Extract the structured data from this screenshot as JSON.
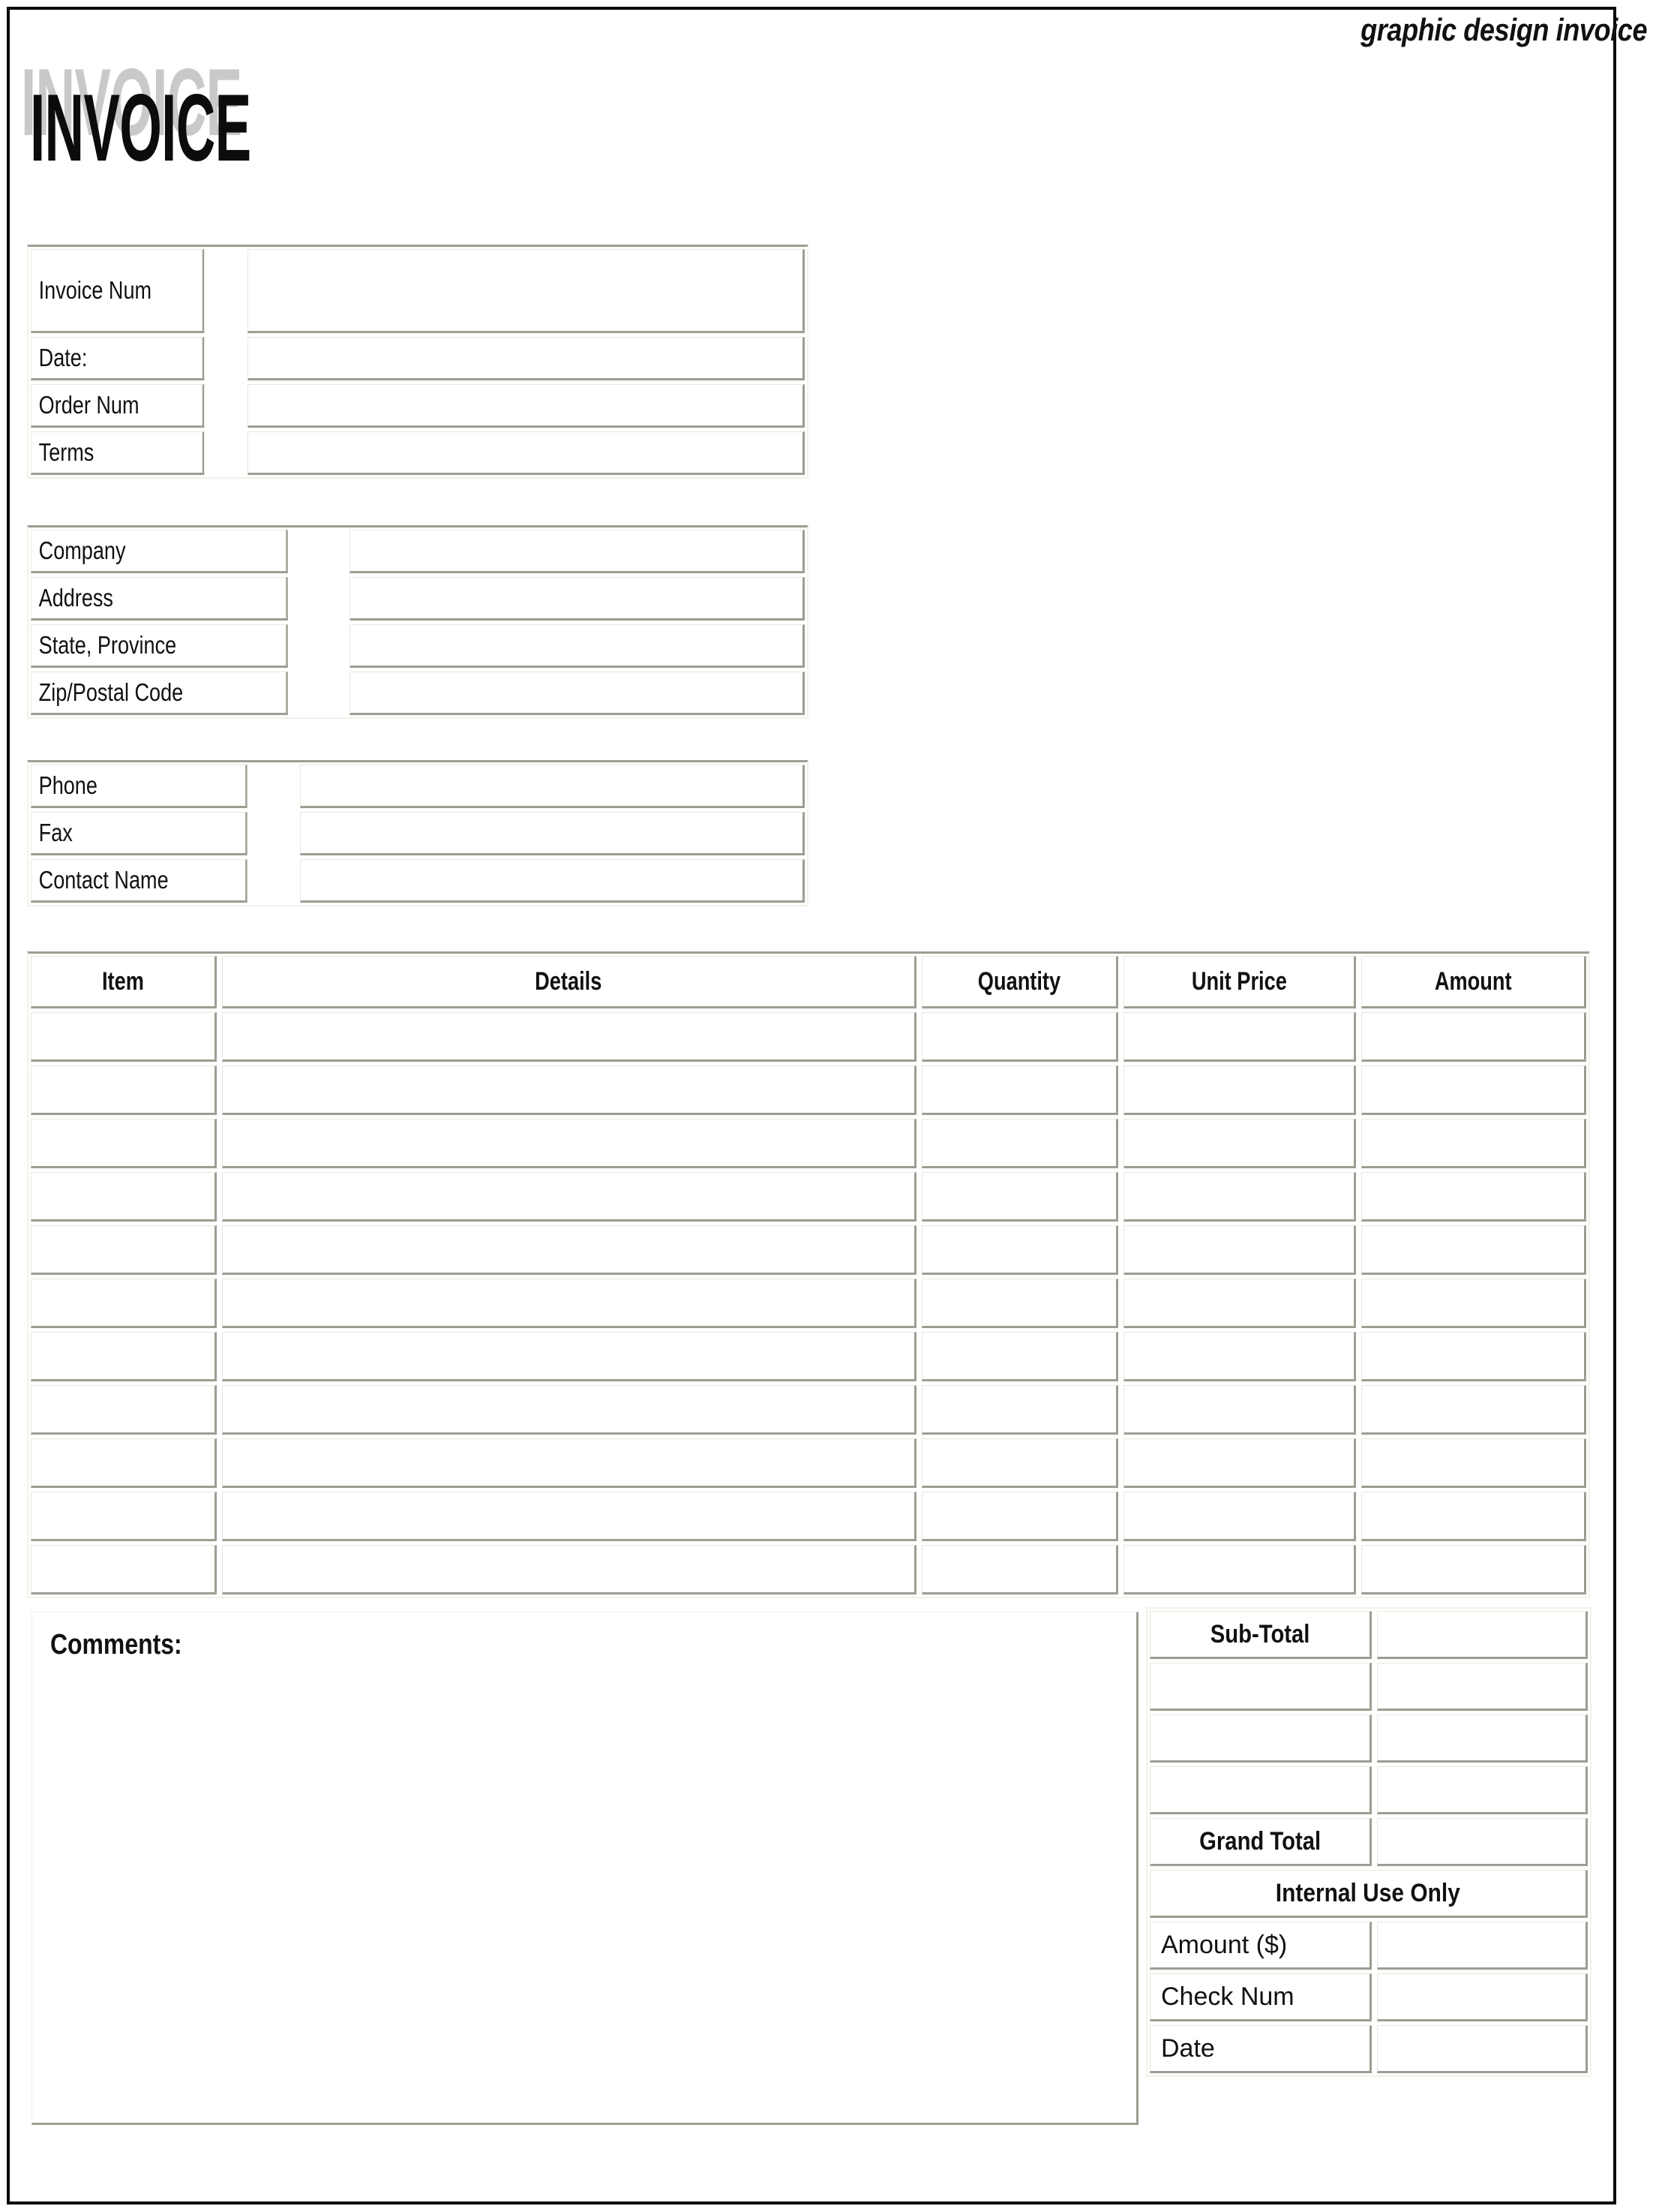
{
  "header": {
    "kicker": "graphic design invoice",
    "title": "INVOICE",
    "title_shadow": "INVOICE"
  },
  "invoice_meta": {
    "fields": [
      {
        "label": "Invoice Num",
        "value": ""
      },
      {
        "label": "Date:",
        "value": ""
      },
      {
        "label": "Order Num",
        "value": ""
      },
      {
        "label": "Terms",
        "value": ""
      }
    ]
  },
  "bill_to": {
    "fields": [
      {
        "label": "Company",
        "value": ""
      },
      {
        "label": "Address",
        "value": ""
      },
      {
        "label": "State, Province",
        "value": ""
      },
      {
        "label": "Zip/Postal Code",
        "value": ""
      }
    ]
  },
  "contact": {
    "fields": [
      {
        "label": "Phone",
        "value": ""
      },
      {
        "label": "Fax",
        "value": ""
      },
      {
        "label": "Contact Name",
        "value": ""
      }
    ]
  },
  "line_items": {
    "columns": [
      "Item",
      "Details",
      "Quantity",
      "Unit Price",
      "Amount"
    ],
    "rows": [
      {
        "item": "",
        "details": "",
        "quantity": "",
        "unit_price": "",
        "amount": ""
      },
      {
        "item": "",
        "details": "",
        "quantity": "",
        "unit_price": "",
        "amount": ""
      },
      {
        "item": "",
        "details": "",
        "quantity": "",
        "unit_price": "",
        "amount": ""
      },
      {
        "item": "",
        "details": "",
        "quantity": "",
        "unit_price": "",
        "amount": ""
      },
      {
        "item": "",
        "details": "",
        "quantity": "",
        "unit_price": "",
        "amount": ""
      },
      {
        "item": "",
        "details": "",
        "quantity": "",
        "unit_price": "",
        "amount": ""
      },
      {
        "item": "",
        "details": "",
        "quantity": "",
        "unit_price": "",
        "amount": ""
      },
      {
        "item": "",
        "details": "",
        "quantity": "",
        "unit_price": "",
        "amount": ""
      },
      {
        "item": "",
        "details": "",
        "quantity": "",
        "unit_price": "",
        "amount": ""
      },
      {
        "item": "",
        "details": "",
        "quantity": "",
        "unit_price": "",
        "amount": ""
      },
      {
        "item": "",
        "details": "",
        "quantity": "",
        "unit_price": "",
        "amount": ""
      }
    ]
  },
  "comments": {
    "label": "Comments:",
    "value": ""
  },
  "totals": {
    "rows": [
      {
        "label": "Sub-Total",
        "value": "",
        "bold": true
      },
      {
        "label": "",
        "value": "",
        "bold": false
      },
      {
        "label": "",
        "value": "",
        "bold": false
      },
      {
        "label": "",
        "value": "",
        "bold": false
      },
      {
        "label": "Grand Total",
        "value": "",
        "bold": true
      }
    ],
    "internal_heading": "Internal Use Only",
    "internal_rows": [
      {
        "label": "Amount ($)",
        "value": ""
      },
      {
        "label": "Check Num",
        "value": ""
      },
      {
        "label": "Date",
        "value": ""
      }
    ]
  },
  "colors": {
    "page_border": "#0a0a0a",
    "cell_shadow": "#9d9d93",
    "cell_light": "#e8e8de",
    "title_shadow": "#c9c9c9",
    "text": "#111111"
  }
}
